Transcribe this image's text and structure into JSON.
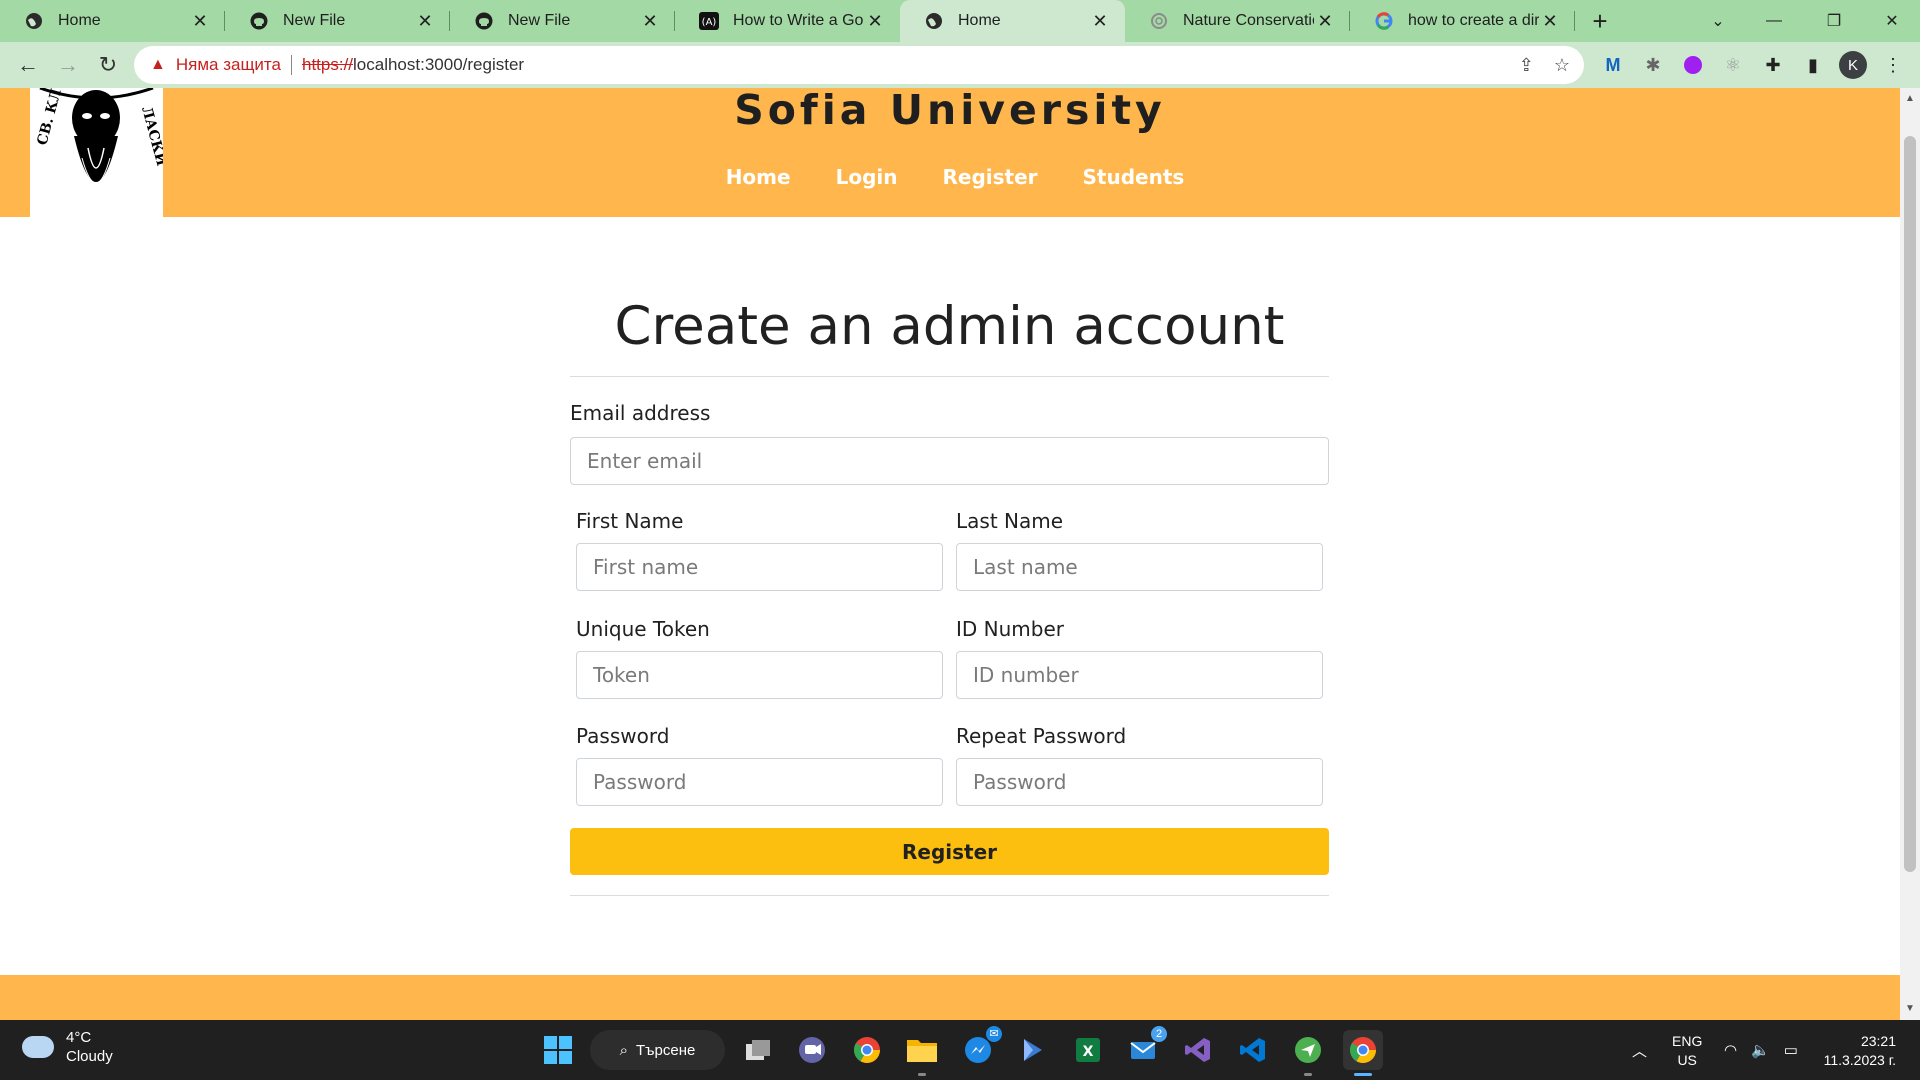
{
  "browser": {
    "tabs": [
      {
        "title": "Home",
        "icon": "globe-icon"
      },
      {
        "title": "New File",
        "icon": "github-icon"
      },
      {
        "title": "New File",
        "icon": "github-icon"
      },
      {
        "title": "How to Write a Good",
        "icon": "dev-icon"
      },
      {
        "title": "Home",
        "icon": "globe-icon",
        "active": true
      },
      {
        "title": "Nature Conservation",
        "icon": "openai-icon"
      },
      {
        "title": "how to create a direct",
        "icon": "google-icon"
      }
    ],
    "security_label": "Няма защита",
    "url_scheme": "https://",
    "url_rest": "localhost:3000/register",
    "profile_initial": "K"
  },
  "site": {
    "brand": "Sofia University",
    "nav": {
      "home": "Home",
      "login": "Login",
      "register": "Register",
      "students": "Students"
    },
    "header_color": "#ffb74d"
  },
  "form": {
    "title": "Create an admin account",
    "email": {
      "label": "Email address",
      "placeholder": "Enter email"
    },
    "first_name": {
      "label": "First Name",
      "placeholder": "First name"
    },
    "last_name": {
      "label": "Last Name",
      "placeholder": "Last name"
    },
    "token": {
      "label": "Unique Token",
      "placeholder": "Token"
    },
    "id_number": {
      "label": "ID Number",
      "placeholder": "ID number"
    },
    "password": {
      "label": "Password",
      "placeholder": "Password"
    },
    "repeat_password": {
      "label": "Repeat Password",
      "placeholder": "Password"
    },
    "submit_label": "Register",
    "submit_color": "#fdbf0f"
  },
  "taskbar": {
    "weather_temp": "4°C",
    "weather_desc": "Cloudy",
    "search_label": "Търсене",
    "lang_top": "ENG",
    "lang_bottom": "US",
    "time": "23:21",
    "date": "11.3.2023 г.",
    "mail_badge": "2"
  }
}
